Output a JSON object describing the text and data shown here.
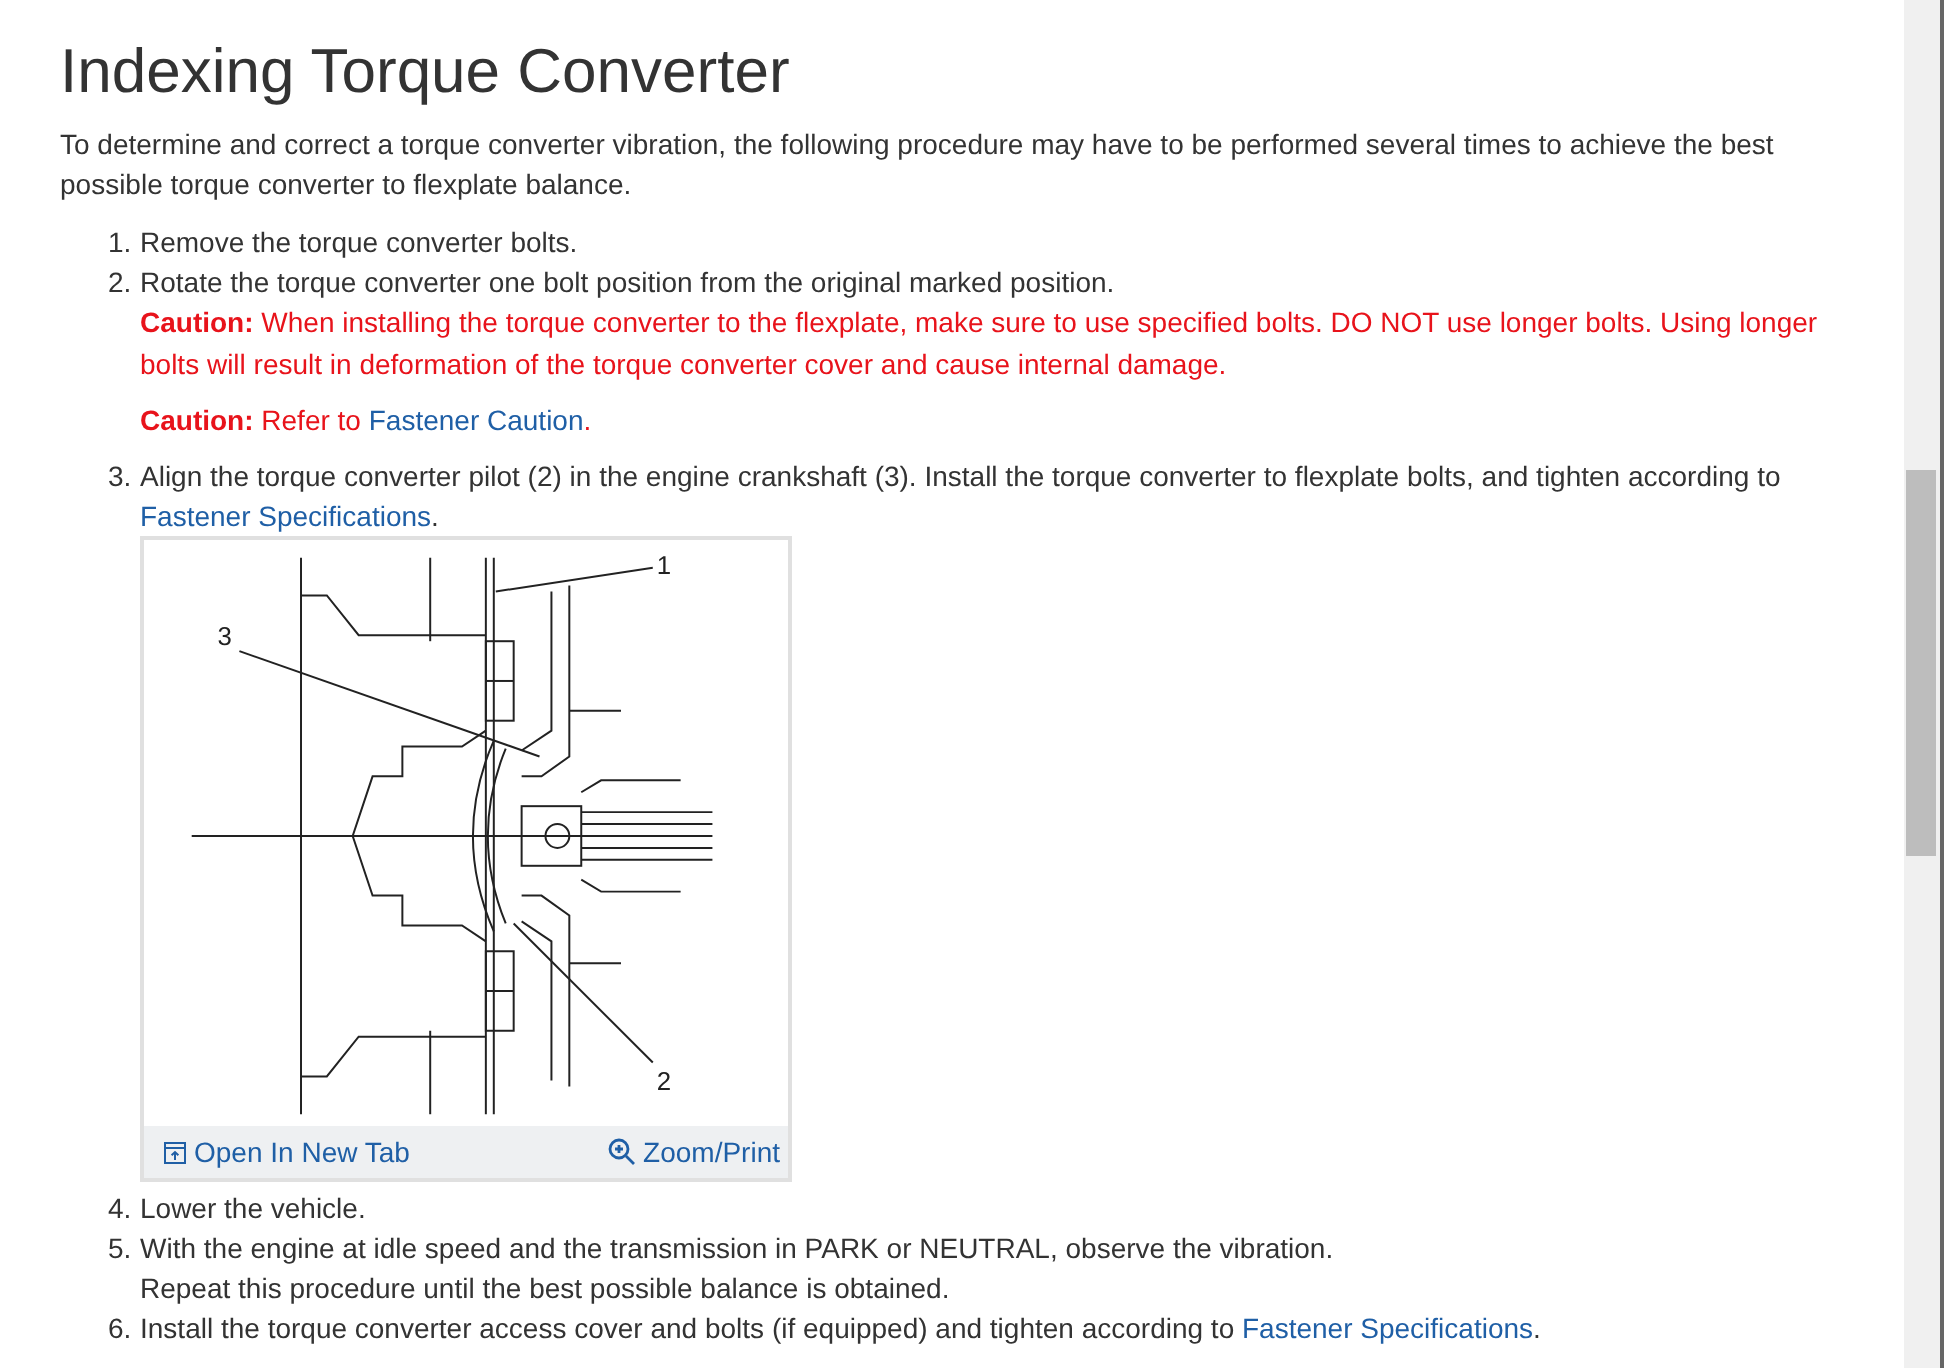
{
  "title": "Indexing Torque Converter",
  "intro": "To determine and correct a torque converter vibration, the following procedure may have to be performed several times to achieve the best possible torque converter to flexplate balance.",
  "steps": [
    {
      "number": "1.",
      "text": "Remove the torque converter bolts."
    },
    {
      "number": "2.",
      "text": "Rotate the torque converter one bolt position from the original marked position.",
      "cautions": [
        {
          "label": "Caution:",
          "text": "When installing the torque converter to the flexplate, make sure to use specified bolts. DO NOT use longer bolts. Using longer bolts will result in deformation of the torque converter cover and cause internal damage."
        },
        {
          "label": "Caution:",
          "text": "Refer to",
          "link": "Fastener Caution",
          "after": "."
        }
      ]
    },
    {
      "number": "3.",
      "text": "Align the torque converter pilot (2) in the engine crankshaft (3). Install the torque converter to flexplate bolts, and tighten according to",
      "link": "Fastener Specifications",
      "after": ".",
      "figure": {
        "callouts": [
          "1",
          "2",
          "3"
        ],
        "open_link": "Open In New Tab",
        "zoom_link": "Zoom/Print"
      }
    },
    {
      "number": "4.",
      "text": "Lower the vehicle."
    },
    {
      "number": "5.",
      "text": "With the engine at idle speed and the transmission in PARK or NEUTRAL, observe the vibration.",
      "note": "Repeat this procedure until the best possible balance is obtained."
    },
    {
      "number": "6.",
      "text": "Install the torque converter access cover and bolts (if equipped) and tighten according to",
      "link": "Fastener Specifications",
      "after": "."
    }
  ]
}
